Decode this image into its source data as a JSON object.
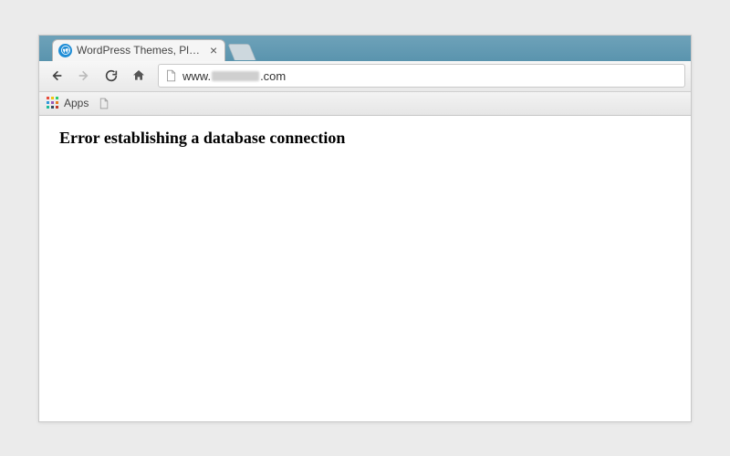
{
  "tab": {
    "title": "WordPress Themes, Plugin"
  },
  "address": {
    "prefix": "www.",
    "suffix": ".com"
  },
  "bookmarks": {
    "apps_label": "Apps"
  },
  "page": {
    "error_heading": "Error establishing a database connection"
  }
}
